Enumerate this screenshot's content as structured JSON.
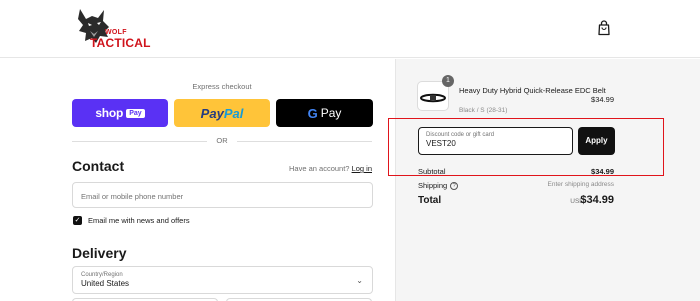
{
  "brand": {
    "logo_top": "WOLF",
    "logo_bottom": "TACTICAL",
    "color": "#d0131b"
  },
  "header": {
    "cart_icon": "shopping-bag-icon"
  },
  "express": {
    "label": "Express checkout",
    "shop_pay": {
      "text": "shop",
      "badge": "Pay",
      "color": "#5a31f4"
    },
    "paypal": {
      "part1": "Pay",
      "part2": "Pal",
      "color": "#ffc439"
    },
    "gpay": {
      "g": "G",
      "text": "Pay",
      "color": "#000000"
    },
    "or_label": "OR"
  },
  "contact": {
    "title": "Contact",
    "have_account": "Have an account?",
    "login_label": "Log in",
    "email_placeholder": "Email or mobile phone number",
    "newsletter_label": "Email me with news and offers",
    "newsletter_checked": true
  },
  "delivery": {
    "title": "Delivery",
    "country_label": "Country/Region",
    "country_value": "United States"
  },
  "summary": {
    "product": {
      "quantity": "1",
      "name": "Heavy Duty Hybrid Quick-Release EDC Belt",
      "variant": "Black / S (28-31)",
      "price": "$34.99"
    },
    "discount": {
      "placeholder": "Discount code or gift card",
      "value": "VEST20",
      "apply_label": "Apply"
    },
    "subtotal_label": "Subtotal",
    "subtotal_value": "$34.99",
    "shipping_label": "Shipping",
    "shipping_value": "Enter shipping address",
    "total_label": "Total",
    "total_currency": "USD",
    "total_value": "$34.99"
  },
  "highlight_color": "#e0141b"
}
